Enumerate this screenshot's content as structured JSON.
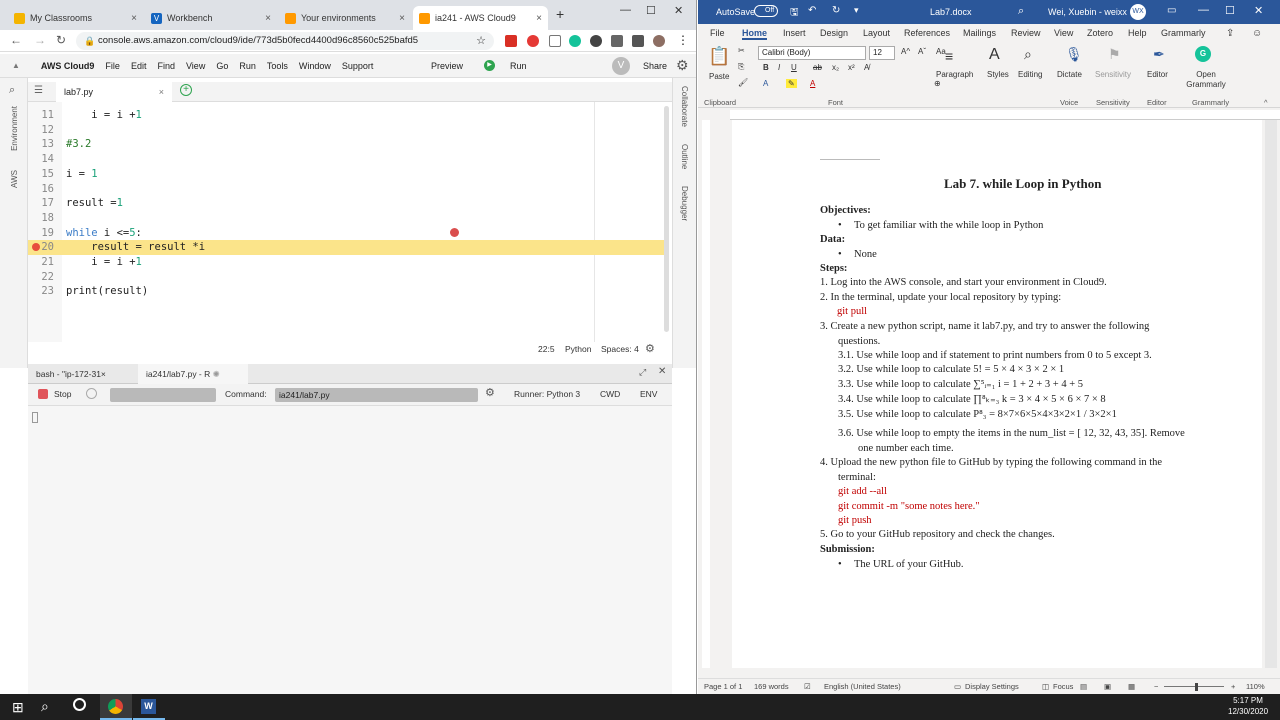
{
  "browser": {
    "tabs": [
      {
        "label": "My Classrooms",
        "color": "#f4b400"
      },
      {
        "label": "Workbench",
        "color": "#1565c0"
      },
      {
        "label": "Your environments",
        "color": "#ff9900"
      },
      {
        "label": "ia241 - AWS Cloud9",
        "color": "#ff9900",
        "active": true
      }
    ],
    "new_tab": "+",
    "url": "console.aws.amazon.com/cloud9/ide/773d5b0fecd4400d96c8560c525bafd5"
  },
  "cloud9": {
    "menu": [
      "AWS Cloud9",
      "File",
      "Edit",
      "Find",
      "View",
      "Go",
      "Run",
      "Tools",
      "Window",
      "Support"
    ],
    "preview": "Preview",
    "run": "Run",
    "avatar": "V",
    "share": "Share",
    "left_rail": [
      "Environment",
      "AWS"
    ],
    "right_rail": [
      "Collaborate",
      "Outline",
      "Debugger"
    ],
    "file_tab": "lab7.py",
    "file_tab_close": "×",
    "add_tab": "+",
    "code_lines": [
      {
        "n": "11",
        "code": "    i = i +1"
      },
      {
        "n": "12",
        "code": ""
      },
      {
        "n": "13",
        "code": "#3.2"
      },
      {
        "n": "14",
        "code": ""
      },
      {
        "n": "15",
        "code": "i = 1"
      },
      {
        "n": "16",
        "code": ""
      },
      {
        "n": "17",
        "code": "result =1"
      },
      {
        "n": "18",
        "code": ""
      },
      {
        "n": "19",
        "code": "while i <=5:"
      },
      {
        "n": "20",
        "code": "    result = result *i",
        "highlight": true,
        "breakpoint": true
      },
      {
        "n": "21",
        "code": "    i = i +1"
      },
      {
        "n": "22",
        "code": ""
      },
      {
        "n": "23",
        "code": "print(result)"
      }
    ],
    "status": {
      "pos": "22:5",
      "lang": "Python",
      "spaces": "Spaces: 4"
    },
    "terminal_tabs": [
      "bash - \"ip-172-31",
      "ia241/lab7.py - R"
    ],
    "runner": {
      "stop": "Stop",
      "command_label": "Command:",
      "command": "ia241/lab7.py",
      "runner": "Runner: Python 3",
      "cwd": "CWD",
      "env": "ENV"
    }
  },
  "word": {
    "autosave": "AutoSave",
    "autosave_state": "Off",
    "filename": "Lab7.docx",
    "user": "Wei, Xuebin - weixx",
    "user_initials": "WX",
    "tabs": [
      "File",
      "Home",
      "Insert",
      "Design",
      "Layout",
      "References",
      "Mailings",
      "Review",
      "View",
      "Zotero",
      "Help",
      "Grammarly"
    ],
    "ribbon": {
      "paste": "Paste",
      "font": "Calibri (Body)",
      "size": "12",
      "paragraph": "Paragraph",
      "styles": "Styles",
      "editing": "Editing",
      "dictate": "Dictate",
      "sensitivity": "Sensitivity",
      "editor": "Editor",
      "open_grammarly": "Open Grammarly",
      "groups": [
        "Clipboard",
        "Font",
        "Voice",
        "Sensitivity",
        "Editor",
        "Grammarly"
      ]
    },
    "doc": {
      "title": "Lab 7. while Loop in Python",
      "objectives_h": "Objectives:",
      "objective": "To get familiar with the while loop in Python",
      "data_h": "Data:",
      "data": "None",
      "steps_h": "Steps:",
      "steps": [
        "1.   Log into the AWS console, and start your environment in Cloud9.",
        "2.   In the terminal, update your local repository by typing:",
        "git pull",
        "3.   Create a new python script, name it lab7.py, and try to answer the following",
        "questions.",
        "3.1.  Use while loop and if statement to print numbers from 0 to 5 except 3.",
        "3.2.  Use while loop to calculate 5! = 5 × 4 × 3 × 2 × 1",
        "3.3.  Use while loop to calculate ∑⁵ᵢ₌₁ i = 1 + 2 + 3 + 4 + 5",
        "3.4.  Use while loop to calculate ∏⁸ₖ₌₃ k = 3 × 4 × 5 × 6 × 7 × 8",
        "3.5.  Use while loop to calculate P⁸₃ = 8×7×6×5×4×3×2×1 / 3×2×1",
        "3.6.  Use while loop to empty the items in the num_list = [ 12, 32, 43, 35]. Remove",
        "one number each time.",
        "4.   Upload the new python file to GitHub by typing the following command in the",
        "terminal:",
        "git add --all",
        "git commit -m \"some notes here.\"",
        "git push",
        "5.   Go to your GitHub repository and check the changes."
      ],
      "submission_h": "Submission:",
      "submission": "The URL of your GitHub."
    },
    "status": {
      "page": "Page 1 of 1",
      "words": "169 words",
      "lang": "English (United States)",
      "display": "Display Settings",
      "focus": "Focus",
      "zoom": "110%"
    }
  },
  "taskbar": {
    "time": "5:17 PM",
    "date": "12/30/2020"
  }
}
